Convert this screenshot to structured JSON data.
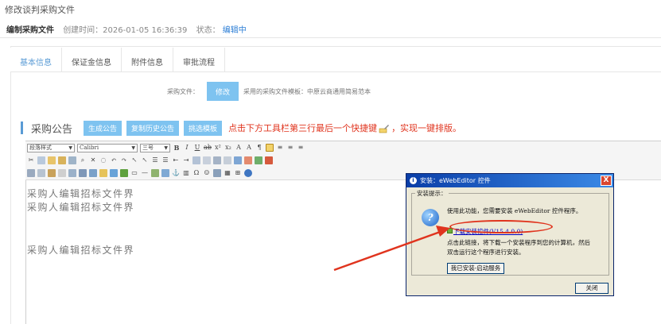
{
  "page": {
    "title": "修改谈判采购文件"
  },
  "status": {
    "doc_name": "编制采购文件",
    "created_label": "创建时间：2026-01-05 16:36:39",
    "state_label": "状态：",
    "state_value": "编辑中"
  },
  "tabs": [
    "基本信息",
    "保证金信息",
    "附件信息",
    "审批流程"
  ],
  "file_row": {
    "label": "采购文件：",
    "modify_button": "修改",
    "template_text": "采用的采购文件模板：中原云商通用简易范本"
  },
  "section": {
    "title": "采购公告",
    "buttons": [
      "生成公告",
      "复制历史公告",
      "挑选模板"
    ],
    "hint": "点击下方工具栏第三行最后一个快捷键",
    "hint_suffix": "，实现一键排版。"
  },
  "toolbar": {
    "style_select": "段落样式",
    "font_select": "Calibri",
    "size_select": "三号"
  },
  "document": {
    "lines": [
      "采购人编辑招标文件界",
      "采购人编辑招标文件界",
      "采购人编辑招标文件界"
    ]
  },
  "dialog": {
    "title": "安装：eWebEditor 控件",
    "close": "X",
    "legend": "安装提示：",
    "line1": "使用此功能，您需要安装 eWebEditor 控件程序。",
    "download_link": "下载安装控件(V15.4.0.0)",
    "line2": "点击此链接，将下载一个安装程序到您的计算机，然后",
    "line3": "双击运行这个程序进行安装。",
    "installed_button": "我已安装-启动服务",
    "close_button": "关闭"
  },
  "colors": {
    "accent": "#7ec3f0",
    "hint": "#e0341e",
    "link": "#2e7fd6",
    "dialog_title": "#0a3ea8"
  }
}
